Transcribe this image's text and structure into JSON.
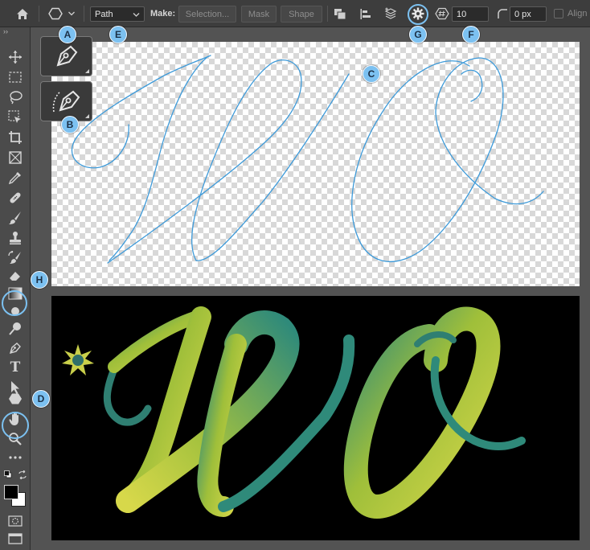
{
  "options_bar": {
    "path_mode": "Path",
    "make_label": "Make:",
    "selection_label": "Selection...",
    "mask_label": "Mask",
    "shape_label": "Shape",
    "sides_value": "10",
    "radius_value": "0 px",
    "align_edges_label": "Align"
  },
  "callouts": {
    "a": "A",
    "b": "B",
    "c": "C",
    "d": "D",
    "e": "E",
    "f": "F",
    "g": "G",
    "h": "H"
  },
  "tools_panel": {
    "collapse_glyph": "››",
    "type_tool_glyph": "T"
  },
  "colors": {
    "accent_callout": "#7cc1f1",
    "path_stroke": "#3d9ad9",
    "ribbon_teal": "#2f8a7a",
    "ribbon_yellow": "#d7d84a"
  }
}
